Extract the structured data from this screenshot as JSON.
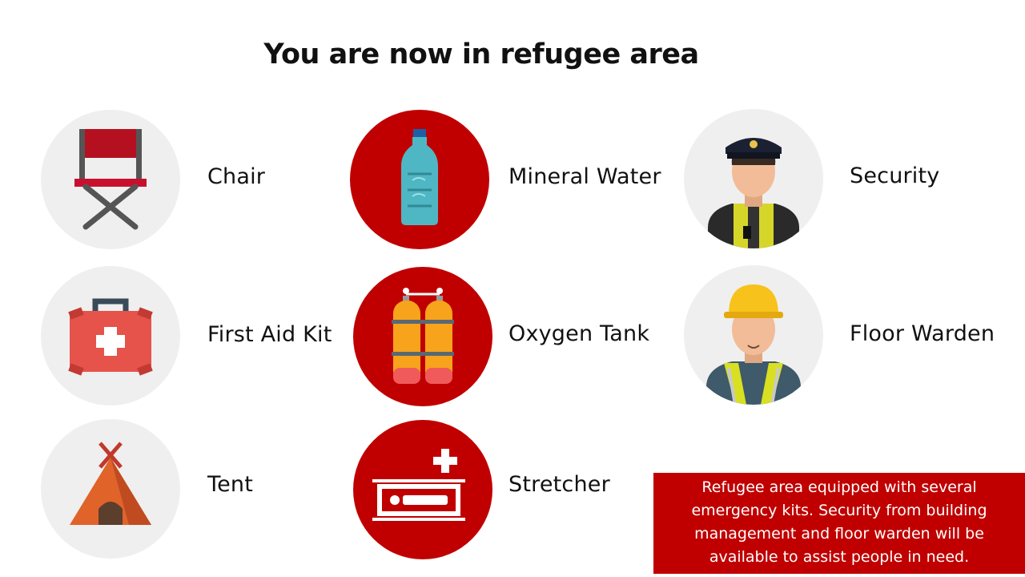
{
  "title": "You are now in refugee area",
  "items": [
    {
      "label": "Chair",
      "icon": "chair-icon"
    },
    {
      "label": "Mineral Water",
      "icon": "water-bottle-icon"
    },
    {
      "label": "Security",
      "icon": "security-guard-icon"
    },
    {
      "label": "First Aid Kit",
      "icon": "first-aid-kit-icon"
    },
    {
      "label": "Oxygen Tank",
      "icon": "oxygen-tank-icon"
    },
    {
      "label": "Floor Warden",
      "icon": "floor-warden-icon"
    },
    {
      "label": "Tent",
      "icon": "tent-icon"
    },
    {
      "label": "Stretcher",
      "icon": "stretcher-icon"
    }
  ],
  "note": "Refugee area equipped with several emergency kits. Security from building management and floor warden will be available to assist people in need.",
  "colors": {
    "accent_red": "#c00000",
    "circle_grey": "#efefef"
  }
}
